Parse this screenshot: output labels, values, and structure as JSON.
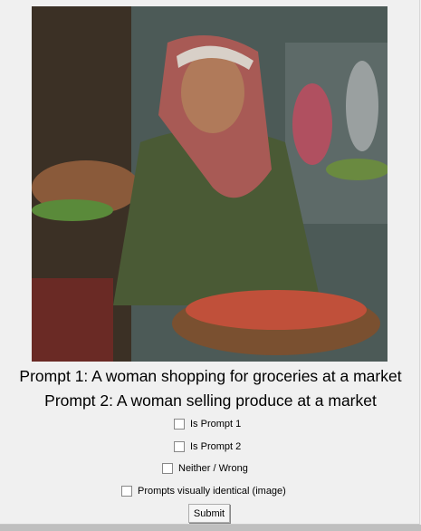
{
  "prompts": {
    "p1": "Prompt 1: A woman shopping for groceries at a market",
    "p2": "Prompt 2: A woman selling produce at a market"
  },
  "options": [
    {
      "label": "Is Prompt 1",
      "checked": false
    },
    {
      "label": "Is Prompt 2",
      "checked": false
    },
    {
      "label": "Neither / Wrong",
      "checked": false
    },
    {
      "label": "Prompts visually identical (image)",
      "checked": false
    }
  ],
  "submit_label": "Submit"
}
